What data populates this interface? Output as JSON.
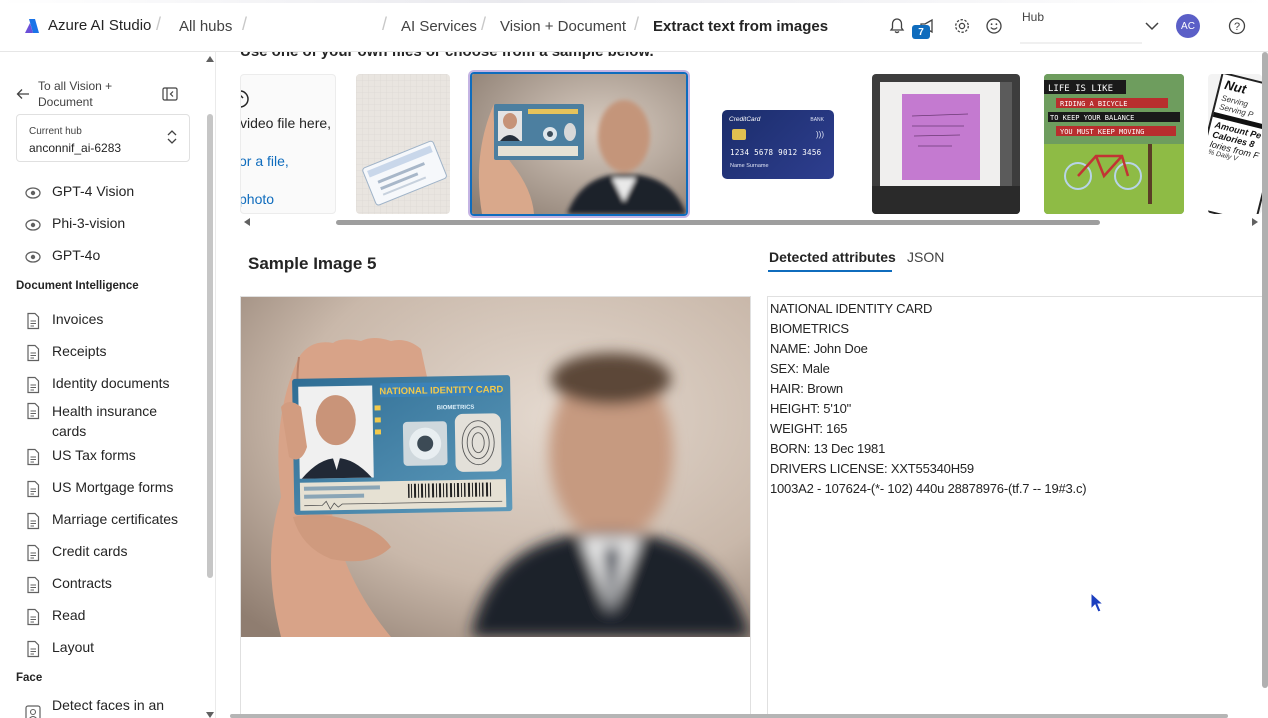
{
  "header": {
    "brand": "Azure AI Studio",
    "breadcrumbs": [
      "All hubs",
      "AI Services",
      "Vision + Document",
      "Extract text from images"
    ],
    "notification_count": "7",
    "hub_label": "Hub",
    "avatar_initials": "AC"
  },
  "sidebar": {
    "back_label": "To all Vision + Document",
    "current_hub_label": "Current hub",
    "current_hub_value": "anconnif_ai-6283",
    "vision_items": [
      "GPT-4 Vision",
      "Phi-3-vision",
      "GPT-4o"
    ],
    "section_doc": "Document Intelligence",
    "doc_items": [
      "Invoices",
      "Receipts",
      "Identity documents",
      "Health insurance cards",
      "US Tax forms",
      "US Mortgage forms",
      "Marriage certificates",
      "Credit cards",
      "Contracts",
      "Read",
      "Layout"
    ],
    "section_face": "Face",
    "face_items": [
      "Detect faces in an"
    ]
  },
  "main": {
    "intro_text": "Use one of your own files or choose from a sample below.",
    "upload_lines": [
      "video file here,",
      "or a file,",
      "photo"
    ],
    "sample_title": "Sample Image 5",
    "tabs": [
      "Detected attributes",
      "JSON"
    ],
    "credit_card_label": "CreditCard",
    "credit_card_bank": "BANK",
    "credit_card_number": "1234 5678 9012 3456",
    "credit_card_name": "Name Surname",
    "poster_lines": [
      "LIFE IS LIKE",
      "RIDING A BICYCLE",
      "TO KEEP YOUR BALANCE",
      "YOU MUST KEEP MOVING"
    ],
    "id_card_title": "NATIONAL IDENTITY CARD",
    "id_card_sub": "BIOMETRICS",
    "nutrition_lines": [
      "Nut",
      "Serving",
      "Serving P",
      "Amount Pe",
      "Calories 8",
      "lories from F",
      "% Daily V"
    ],
    "attributes": [
      "NATIONAL IDENTITY CARD",
      "BIOMETRICS",
      "NAME: John Doe",
      "SEX: Male",
      "HAIR: Brown",
      "HEIGHT: 5'10\"",
      "WEIGHT: 165",
      "BORN: 13 Dec 1981",
      "DRIVERS LICENSE: XXT55340H59",
      "1003A2 - 107624-(*- 102) 440u 28878976-(tf.7 -- 19#3.c)"
    ]
  },
  "colors": {
    "accent": "#0f6cbd",
    "selection_glow": "#c5b4e3",
    "avatar": "#5b5fc7"
  }
}
